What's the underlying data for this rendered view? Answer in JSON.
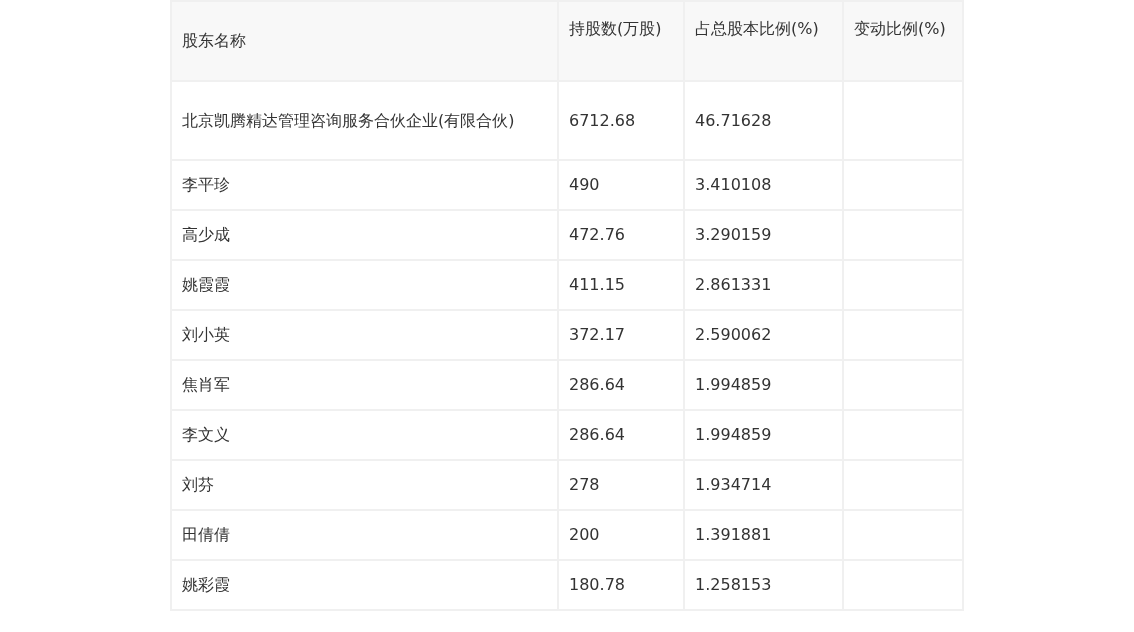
{
  "table": {
    "columns": [
      "股东名称",
      "持股数(万股)",
      "占总股本比例(%)",
      "变动比例(%)"
    ],
    "rows": [
      {
        "name": "北京凯腾精达管理咨询服务合伙企业(有限合伙)",
        "shares": "6712.68",
        "ratio": "46.71628"
      },
      {
        "name": "李平珍",
        "shares": "490",
        "ratio": "3.410108"
      },
      {
        "name": "高少成",
        "shares": "472.76",
        "ratio": "3.290159"
      },
      {
        "name": "姚霞霞",
        "shares": "411.15",
        "ratio": "2.861331"
      },
      {
        "name": "刘小英",
        "shares": "372.17",
        "ratio": "2.590062"
      },
      {
        "name": "焦肖军",
        "shares": "286.64",
        "ratio": "1.994859"
      },
      {
        "name": "李文义",
        "shares": "286.64",
        "ratio": "1.994859"
      },
      {
        "name": "刘芬",
        "shares": "278",
        "ratio": "1.934714"
      },
      {
        "name": "田倩倩",
        "shares": "200",
        "ratio": "1.391881"
      },
      {
        "name": "姚彩霞",
        "shares": "180.78",
        "ratio": "1.258153"
      }
    ]
  }
}
